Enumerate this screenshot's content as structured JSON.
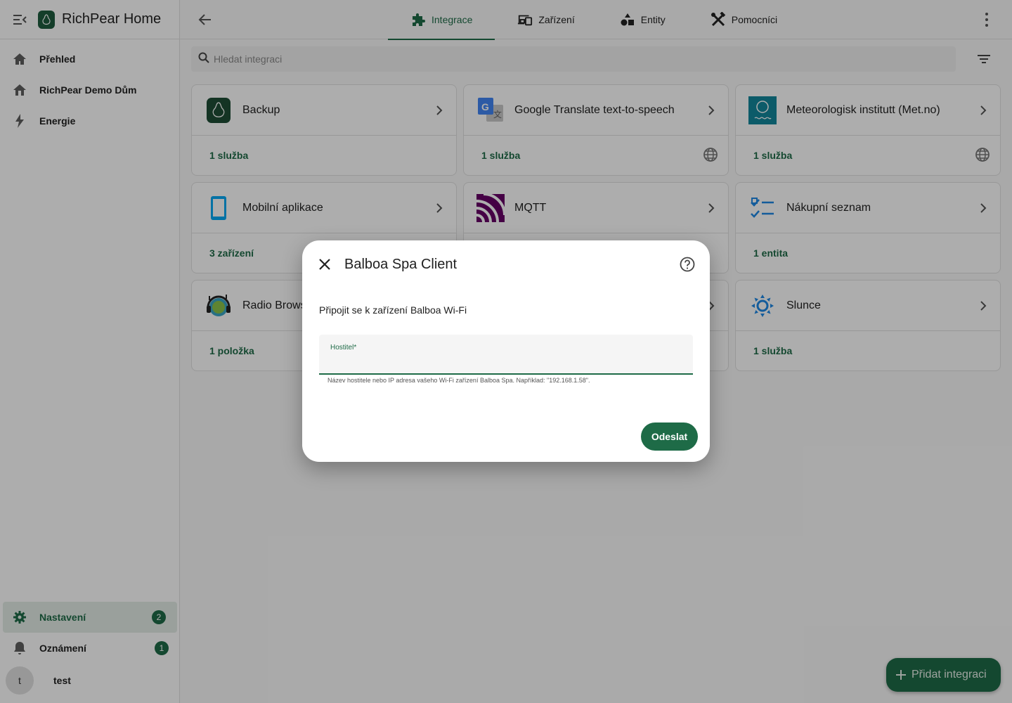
{
  "app": {
    "title": "RichPear Home"
  },
  "sidebar": {
    "items": [
      {
        "label": "Přehled",
        "icon": "home-icon"
      },
      {
        "label": "RichPear Demo Dům",
        "icon": "home-outline-icon"
      },
      {
        "label": "Energie",
        "icon": "lightning-icon"
      }
    ],
    "bottom": [
      {
        "label": "Nastavení",
        "icon": "gear-icon",
        "badge": "2"
      },
      {
        "label": "Oznámení",
        "icon": "bell-icon",
        "badge": "1"
      }
    ],
    "user": {
      "initial": "t",
      "name": "test"
    }
  },
  "tabs": [
    {
      "label": "Integrace",
      "icon": "puzzle-icon",
      "active": true
    },
    {
      "label": "Zařízení",
      "icon": "devices-icon"
    },
    {
      "label": "Entity",
      "icon": "shapes-icon"
    },
    {
      "label": "Pomocníci",
      "icon": "tools-icon"
    }
  ],
  "search": {
    "placeholder": "Hledat integraci"
  },
  "integrations": [
    {
      "name": "Backup",
      "footer": "1 služba",
      "icon": "backup-logo",
      "cloud": false
    },
    {
      "name": "Google Translate text-to-speech",
      "footer": "1 služba",
      "icon": "google-translate-logo",
      "cloud": true
    },
    {
      "name": "Meteorologisk institutt (Met.no)",
      "footer": "1 služba",
      "icon": "met-no-logo",
      "cloud": true
    },
    {
      "name": "Mobilní aplikace",
      "footer": "3 zařízení",
      "icon": "phone-icon",
      "cloud": false
    },
    {
      "name": "MQTT",
      "footer": "",
      "icon": "mqtt-logo",
      "cloud": false
    },
    {
      "name": "Nákupní seznam",
      "footer": "1 entita",
      "icon": "checklist-icon",
      "cloud": false
    },
    {
      "name": "Radio Browser",
      "footer": "1 položka",
      "icon": "radio-browser-logo",
      "cloud": false
    },
    {
      "name": "",
      "footer": "",
      "icon": "",
      "cloud": false
    },
    {
      "name": "Slunce",
      "footer": "1 služba",
      "icon": "sun-icon",
      "cloud": false
    }
  ],
  "fab": {
    "label": "Přidat integraci"
  },
  "dialog": {
    "title": "Balboa Spa Client",
    "description": "Připojit se k zařízení Balboa Wi-Fi",
    "field_label": "Hostitel*",
    "field_value": "",
    "helper": "Název hostitele nebo IP adresa vašeho Wi-Fi zařízení Balboa Spa. Například: \"192.168.1.58\".",
    "submit": "Odeslat"
  },
  "colors": {
    "accent": "#1e6b47",
    "scrim": "rgba(0,0,0,0.32)"
  }
}
